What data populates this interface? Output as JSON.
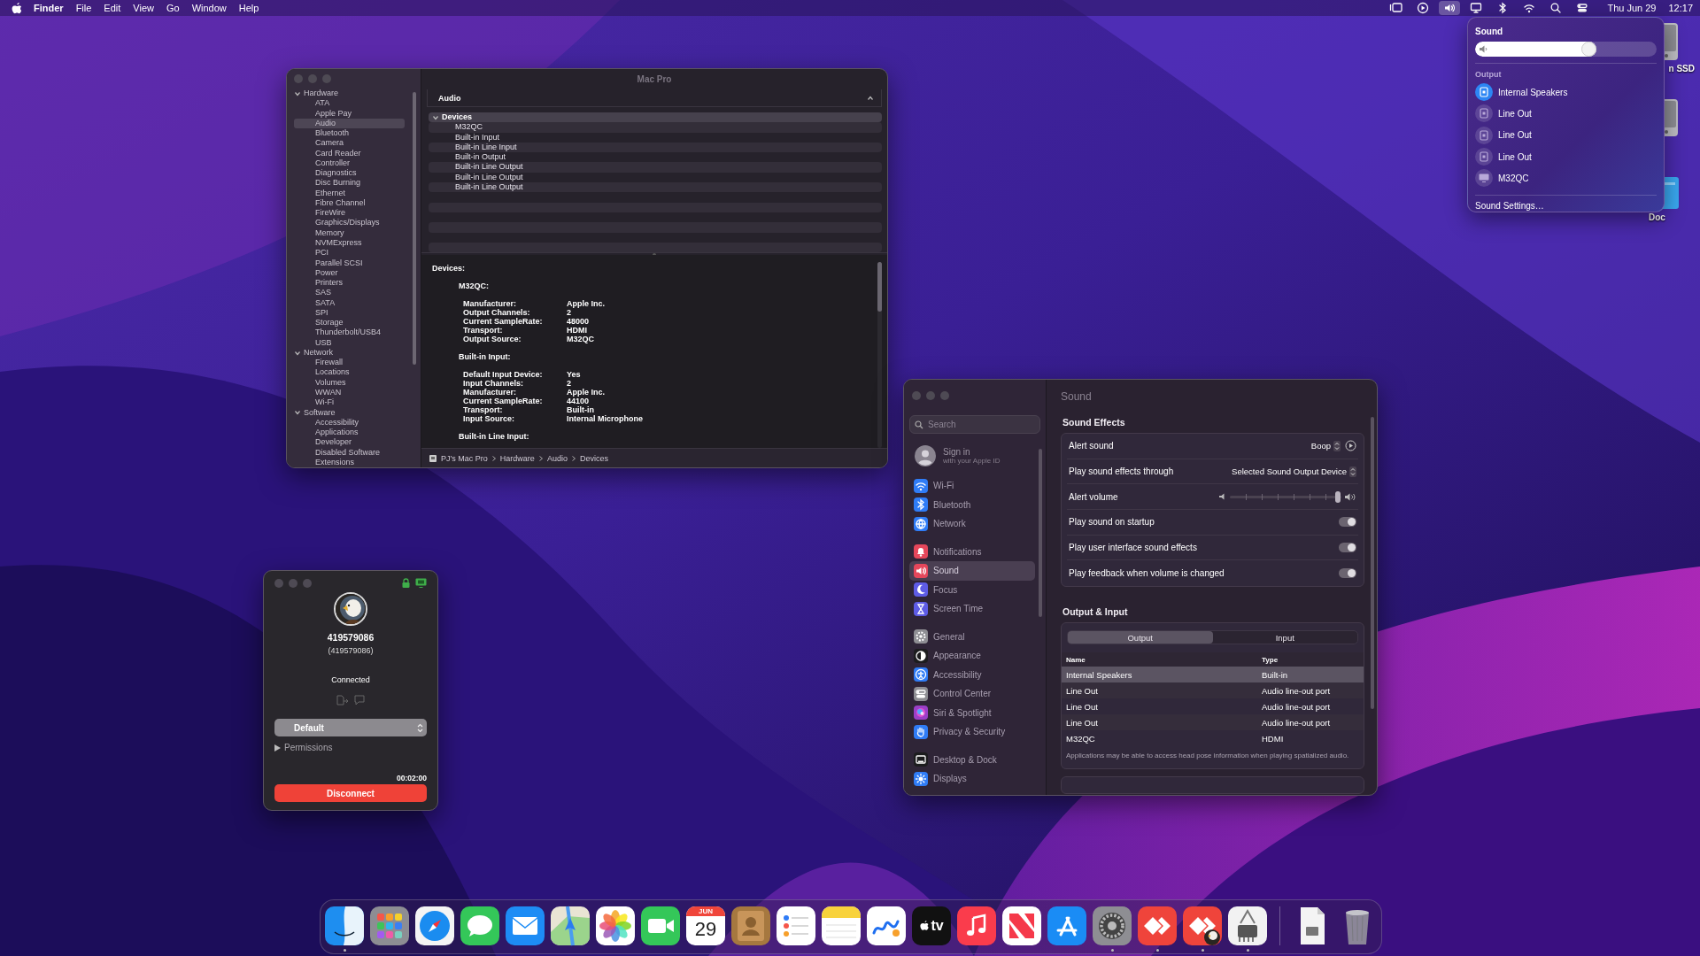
{
  "menu_bar": {
    "app_name": "Finder",
    "menus": [
      "File",
      "Edit",
      "View",
      "Go",
      "Window",
      "Help"
    ],
    "status_items": [
      {
        "kind": "stage",
        "selected": false
      },
      {
        "kind": "play",
        "selected": false
      },
      {
        "kind": "volume",
        "selected": true
      },
      {
        "kind": "display",
        "selected": false
      },
      {
        "kind": "bluetooth",
        "selected": false
      },
      {
        "kind": "wifi",
        "selected": false
      },
      {
        "kind": "search",
        "selected": false
      },
      {
        "kind": "control",
        "selected": false
      }
    ],
    "date": "Thu Jun 29",
    "time": "12:17"
  },
  "desktop_icons": [
    {
      "kind": "disk",
      "label": "n SSD"
    },
    {
      "kind": "disk"
    },
    {
      "kind": "document",
      "label": "Doc"
    }
  ],
  "system_information": {
    "title": "Mac Pro",
    "sidebar": [
      {
        "label": "Hardware",
        "expanded": true,
        "children": [
          {
            "label": "ATA",
            "selected": false
          },
          {
            "label": "Apple Pay",
            "selected": false
          },
          {
            "label": "Audio",
            "selected": true
          },
          {
            "label": "Bluetooth",
            "selected": false
          },
          {
            "label": "Camera",
            "selected": false
          },
          {
            "label": "Card Reader",
            "selected": false
          },
          {
            "label": "Controller",
            "selected": false
          },
          {
            "label": "Diagnostics",
            "selected": false
          },
          {
            "label": "Disc Burning",
            "selected": false
          },
          {
            "label": "Ethernet",
            "selected": false
          },
          {
            "label": "Fibre Channel",
            "selected": false
          },
          {
            "label": "FireWire",
            "selected": false
          },
          {
            "label": "Graphics/Displays",
            "selected": false
          },
          {
            "label": "Memory",
            "selected": false
          },
          {
            "label": "NVMExpress",
            "selected": false
          },
          {
            "label": "PCI",
            "selected": false
          },
          {
            "label": "Parallel SCSI",
            "selected": false
          },
          {
            "label": "Power",
            "selected": false
          },
          {
            "label": "Printers",
            "selected": false
          },
          {
            "label": "SAS",
            "selected": false
          },
          {
            "label": "SATA",
            "selected": false
          },
          {
            "label": "SPI",
            "selected": false
          },
          {
            "label": "Storage",
            "selected": false
          },
          {
            "label": "Thunderbolt/USB4",
            "selected": false
          },
          {
            "label": "USB",
            "selected": false
          }
        ]
      },
      {
        "label": "Network",
        "expanded": true,
        "children": [
          {
            "label": "Firewall",
            "selected": false
          },
          {
            "label": "Locations",
            "selected": false
          },
          {
            "label": "Volumes",
            "selected": false
          },
          {
            "label": "WWAN",
            "selected": false
          },
          {
            "label": "Wi-Fi",
            "selected": false
          }
        ]
      },
      {
        "label": "Software",
        "expanded": true,
        "children": [
          {
            "label": "Accessibility",
            "selected": false
          },
          {
            "label": "Applications",
            "selected": false
          },
          {
            "label": "Developer",
            "selected": false
          },
          {
            "label": "Disabled Software",
            "selected": false
          },
          {
            "label": "Extensions",
            "selected": false
          }
        ]
      }
    ],
    "section_title": "Audio",
    "device_tree": {
      "label": "Devices",
      "expanded": true,
      "selected": true,
      "children": [
        {
          "label": "M32QC",
          "selected": false
        },
        {
          "label": "Built-in Input",
          "selected": false
        },
        {
          "label": "Built-in Line Input",
          "selected": false
        },
        {
          "label": "Built-in Output",
          "selected": false
        },
        {
          "label": "Built-in Line Output",
          "selected": false
        },
        {
          "label": "Built-in Line Output",
          "selected": false
        },
        {
          "label": "Built-in Line Output",
          "selected": false
        }
      ]
    },
    "details": {
      "heading": "Devices:",
      "devices": [
        {
          "name": "M32QC:",
          "properties": [
            {
              "label": "Manufacturer:",
              "value": "Apple Inc."
            },
            {
              "label": "Output Channels:",
              "value": "2"
            },
            {
              "label": "Current SampleRate:",
              "value": "48000"
            },
            {
              "label": "Transport:",
              "value": "HDMI"
            },
            {
              "label": "Output Source:",
              "value": "M32QC"
            }
          ]
        },
        {
          "name": "Built-in Input:",
          "properties": [
            {
              "label": "Default Input Device:",
              "value": "Yes"
            },
            {
              "label": "Input Channels:",
              "value": "2"
            },
            {
              "label": "Manufacturer:",
              "value": "Apple Inc."
            },
            {
              "label": "Current SampleRate:",
              "value": "44100"
            },
            {
              "label": "Transport:",
              "value": "Built-in"
            },
            {
              "label": "Input Source:",
              "value": "Internal Microphone"
            }
          ]
        },
        {
          "name": "Built-in Line Input:"
        }
      ]
    },
    "breadcrumb": [
      "PJ’s Mac Pro",
      "Hardware",
      "Audio",
      "Devices"
    ]
  },
  "sound_settings": {
    "search": {
      "placeholder": "Search"
    },
    "account": {
      "title": "Sign in",
      "subtitle": "with your Apple ID"
    },
    "sidebar_groups": [
      [
        {
          "kind": "wifi",
          "label": "Wi-Fi",
          "color": "#2f7cf6",
          "selected": false
        },
        {
          "kind": "bluetooth",
          "label": "Bluetooth",
          "color": "#2f7cf6",
          "selected": false
        },
        {
          "kind": "network",
          "label": "Network",
          "color": "#2f7cf6",
          "selected": false
        }
      ],
      [
        {
          "kind": "notifications",
          "label": "Notifications",
          "color": "#e5475b",
          "selected": false
        },
        {
          "kind": "sound",
          "label": "Sound",
          "color": "#e5475b",
          "selected": true
        },
        {
          "kind": "focus",
          "label": "Focus",
          "color": "#5e5ce6",
          "selected": false
        },
        {
          "kind": "screen_time",
          "label": "Screen Time",
          "color": "#5e5ce6",
          "selected": false
        }
      ],
      [
        {
          "kind": "general",
          "label": "General",
          "color": "#8e8e93",
          "selected": false
        },
        {
          "kind": "appearance",
          "label": "Appearance",
          "color": "#1c1c1e",
          "selected": false
        },
        {
          "kind": "accessibility",
          "label": "Accessibility",
          "color": "#2f7cf6",
          "selected": false
        },
        {
          "kind": "control_center",
          "label": "Control Center",
          "color": "#8e8e93",
          "selected": false
        },
        {
          "kind": "siri",
          "label": "Siri & Spotlight",
          "color": "#9b3fc8",
          "selected": false
        },
        {
          "kind": "privacy",
          "label": "Privacy & Security",
          "color": "#2f7cf6",
          "selected": false
        }
      ],
      [
        {
          "kind": "desktop_dock",
          "label": "Desktop & Dock",
          "color": "#1c1c1e",
          "selected": false
        },
        {
          "kind": "displays",
          "label": "Displays",
          "color": "#2f7cf6",
          "selected": false
        }
      ]
    ],
    "page_title": "Sound",
    "effects_title": "Sound Effects",
    "effects": [
      {
        "kind": "popup",
        "label": "Alert sound",
        "value": "Boop",
        "preview": true
      },
      {
        "kind": "popup",
        "label": "Play sound effects through",
        "value": "Selected Sound Output Device",
        "preview": false
      },
      {
        "kind": "slider",
        "label": "Alert volume",
        "level": 0.97
      },
      {
        "kind": "toggle",
        "label": "Play sound on startup",
        "on": true
      },
      {
        "kind": "toggle",
        "label": "Play user interface sound effects",
        "on": true
      },
      {
        "kind": "toggle",
        "label": "Play feedback when volume is changed",
        "on": true
      }
    ],
    "io_title": "Output & Input",
    "io_tabs": [
      {
        "label": "Output",
        "selected": true
      },
      {
        "label": "Input",
        "selected": false
      }
    ],
    "device_table": {
      "columns": [
        "Name",
        "Type"
      ],
      "rows": [
        {
          "name": "Internal Speakers",
          "type": "Built-in",
          "selected": true
        },
        {
          "name": "Line Out",
          "type": "Audio line-out port",
          "selected": false
        },
        {
          "name": "Line Out",
          "type": "Audio line-out port",
          "selected": false
        },
        {
          "name": "Line Out",
          "type": "Audio line-out port",
          "selected": false
        },
        {
          "name": "M32QC",
          "type": "HDMI",
          "selected": false
        }
      ]
    },
    "note": "Applications may be able to access head pose information when playing spatialized audio."
  },
  "remote_session": {
    "id": "419579086",
    "id_detail": "(419579086)",
    "status": "Connected",
    "profile": "Default",
    "permissions": {
      "label": "Permissions",
      "expanded": false
    },
    "timer": "00:02:00",
    "disconnect": "Disconnect"
  },
  "sound_menu": {
    "title": "Sound",
    "volume": {
      "level": 0.67
    },
    "output_label": "Output",
    "devices": [
      {
        "kind": "speaker",
        "name": "Internal Speakers",
        "selected": true
      },
      {
        "kind": "speaker",
        "name": "Line Out",
        "selected": false
      },
      {
        "kind": "speaker",
        "name": "Line Out",
        "selected": false
      },
      {
        "kind": "speaker",
        "name": "Line Out",
        "selected": false
      },
      {
        "kind": "display",
        "name": "M32QC",
        "selected": false
      }
    ],
    "settings_link": "Sound Settings…"
  },
  "dock": {
    "items": [
      {
        "kind": "finder",
        "running": true
      },
      {
        "kind": "launchpad",
        "running": false
      },
      {
        "kind": "safari",
        "running": false
      },
      {
        "kind": "messages",
        "running": false
      },
      {
        "kind": "mail",
        "running": false
      },
      {
        "kind": "maps",
        "running": false
      },
      {
        "kind": "photos",
        "running": false
      },
      {
        "kind": "facetime",
        "running": false
      },
      {
        "kind": "calendar",
        "month": "JUN",
        "day": "29",
        "running": false
      },
      {
        "kind": "contacts",
        "running": false
      },
      {
        "kind": "reminders",
        "running": false
      },
      {
        "kind": "notes",
        "running": false
      },
      {
        "kind": "freeform",
        "running": false
      },
      {
        "kind": "tv",
        "label": "tv",
        "running": false
      },
      {
        "kind": "music",
        "running": false
      },
      {
        "kind": "news",
        "running": false
      },
      {
        "kind": "appstore",
        "running": false
      },
      {
        "kind": "settings",
        "running": true
      },
      {
        "kind": "remote",
        "running": true
      },
      {
        "kind": "remote_badge",
        "running": true
      },
      {
        "kind": "sysinfo",
        "running": true
      },
      {
        "kind": "separator"
      },
      {
        "kind": "document",
        "running": false
      },
      {
        "kind": "trash",
        "running": false
      }
    ]
  }
}
